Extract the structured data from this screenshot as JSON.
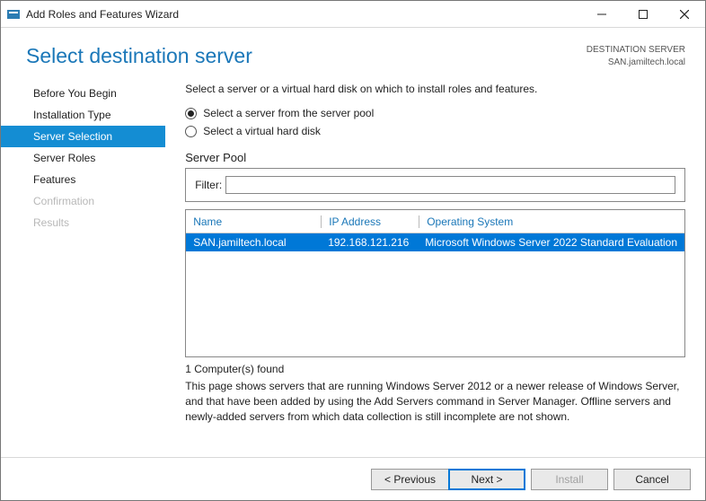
{
  "window": {
    "title": "Add Roles and Features Wizard"
  },
  "header": {
    "title": "Select destination server",
    "dest_label": "DESTINATION SERVER",
    "dest_value": "SAN.jamiltech.local"
  },
  "sidebar": {
    "items": [
      {
        "label": "Before You Begin",
        "state": ""
      },
      {
        "label": "Installation Type",
        "state": ""
      },
      {
        "label": "Server Selection",
        "state": "active"
      },
      {
        "label": "Server Roles",
        "state": ""
      },
      {
        "label": "Features",
        "state": ""
      },
      {
        "label": "Confirmation",
        "state": "disabled"
      },
      {
        "label": "Results",
        "state": "disabled"
      }
    ]
  },
  "main": {
    "intro": "Select a server or a virtual hard disk on which to install roles and features.",
    "radios": [
      {
        "label": "Select a server from the server pool",
        "selected": true
      },
      {
        "label": "Select a virtual hard disk",
        "selected": false
      }
    ],
    "pool_label": "Server Pool",
    "filter_label": "Filter:",
    "filter_value": "",
    "columns": {
      "name": "Name",
      "ip": "IP Address",
      "os": "Operating System"
    },
    "rows": [
      {
        "name": "SAN.jamiltech.local",
        "ip": "192.168.121.216",
        "os": "Microsoft Windows Server 2022 Standard Evaluation"
      }
    ],
    "count": "1 Computer(s) found",
    "desc": "This page shows servers that are running Windows Server 2012 or a newer release of Windows Server, and that have been added by using the Add Servers command in Server Manager. Offline servers and newly-added servers from which data collection is still incomplete are not shown."
  },
  "footer": {
    "previous": "< Previous",
    "next": "Next >",
    "install": "Install",
    "cancel": "Cancel"
  }
}
